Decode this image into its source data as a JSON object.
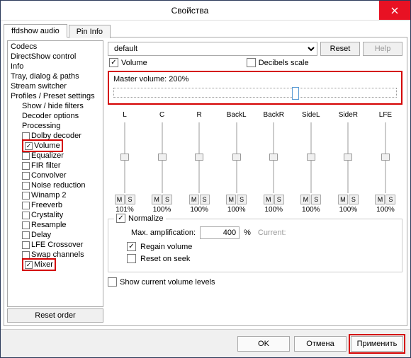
{
  "window": {
    "title": "Свойства"
  },
  "tabs": {
    "active": "ffdshow audio",
    "inactive": "Pin Info"
  },
  "sidebar": {
    "items": [
      {
        "label": "Codecs"
      },
      {
        "label": "DirectShow control"
      },
      {
        "label": "Info"
      },
      {
        "label": "Tray, dialog & paths"
      },
      {
        "label": "Stream switcher"
      },
      {
        "label": "Profiles / Preset settings"
      },
      {
        "label": "Show / hide filters",
        "indent": 1
      },
      {
        "label": "Decoder options",
        "indent": 1
      },
      {
        "label": "Processing",
        "indent": 1
      },
      {
        "label": "Dolby decoder",
        "indent": 1,
        "cb": ""
      },
      {
        "label": "Volume",
        "indent": 1,
        "cb": "✓",
        "hl": true
      },
      {
        "label": "Equalizer",
        "indent": 1,
        "cb": ""
      },
      {
        "label": "FIR filter",
        "indent": 1,
        "cb": ""
      },
      {
        "label": "Convolver",
        "indent": 1,
        "cb": ""
      },
      {
        "label": "Noise reduction",
        "indent": 1,
        "cb": ""
      },
      {
        "label": "Winamp 2",
        "indent": 1,
        "cb": ""
      },
      {
        "label": "Freeverb",
        "indent": 1,
        "cb": ""
      },
      {
        "label": "Crystality",
        "indent": 1,
        "cb": ""
      },
      {
        "label": "Resample",
        "indent": 1,
        "cb": ""
      },
      {
        "label": "Delay",
        "indent": 1,
        "cb": ""
      },
      {
        "label": "LFE Crossover",
        "indent": 1,
        "cb": ""
      },
      {
        "label": "Swap channels",
        "indent": 1,
        "cb": ""
      },
      {
        "label": "Mixer",
        "indent": 1,
        "cb": "✓",
        "hl": true
      }
    ],
    "reset_order": "Reset order"
  },
  "main": {
    "preset": "default",
    "reset": "Reset",
    "help": "Help",
    "volume_cb": "Volume",
    "decibels_cb": "Decibels scale",
    "master_label": "Master volume: 200%",
    "channels": [
      {
        "label": "L",
        "pct": "101%"
      },
      {
        "label": "C",
        "pct": "100%"
      },
      {
        "label": "R",
        "pct": "100%"
      },
      {
        "label": "BackL",
        "pct": "100%"
      },
      {
        "label": "BackR",
        "pct": "100%"
      },
      {
        "label": "SideL",
        "pct": "100%"
      },
      {
        "label": "SideR",
        "pct": "100%"
      },
      {
        "label": "LFE",
        "pct": "100%"
      }
    ],
    "m": "M",
    "s": "S",
    "normalize": "Normalize",
    "max_amp_label": "Max. amplification:",
    "max_amp_value": "400",
    "percent": "%",
    "current": "Current:",
    "regain": "Regain volume",
    "reset_seek": "Reset on seek",
    "show_levels": "Show current volume levels"
  },
  "footer": {
    "ok": "OK",
    "cancel": "Отмена",
    "apply": "Применить"
  }
}
